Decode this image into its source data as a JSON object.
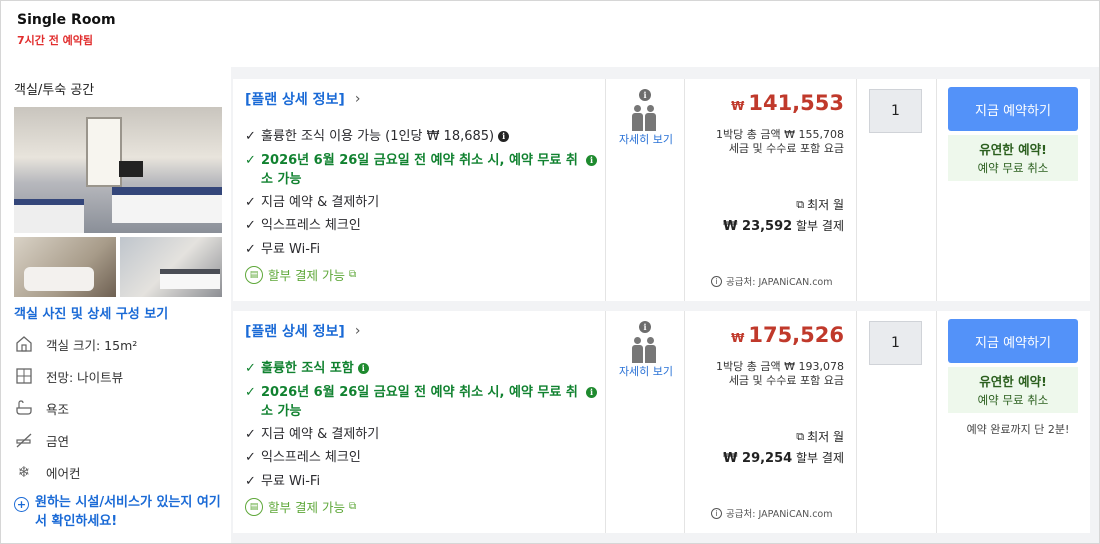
{
  "header": {
    "room_name": "Single Room",
    "booked_note": "7시간 전 예약됨"
  },
  "left_panel": {
    "section_title": "객실/투숙 공간",
    "photos_link": "객실 사진 및 상세 구성 보기",
    "amenities": [
      {
        "icon": "house-icon",
        "label": "객실 크기: 15m²"
      },
      {
        "icon": "window-icon",
        "label": "전망: 나이트뷰"
      },
      {
        "icon": "bathtub-icon",
        "label": "욕조"
      },
      {
        "icon": "no-smoking-icon",
        "label": "금연"
      },
      {
        "icon": "snowflake-icon",
        "label": "에어컨"
      }
    ],
    "more_link": "원하는 시설/서비스가 있는지 여기서 확인하세요!"
  },
  "offers": [
    {
      "plan_link": "[플랜 상세 정보]",
      "features": [
        {
          "text": "훌륭한 조식 이용 가능 (1인당 ₩ 18,685)",
          "green": false
        },
        {
          "text": "2026년 6월 26일 금요일 전 예약 취소 시, 예약 무료 취소 가능",
          "green": true
        },
        {
          "text": "지금 예약 & 결제하기",
          "green": false
        },
        {
          "text": "익스프레스 체크인",
          "green": false
        },
        {
          "text": "무료 Wi-Fi",
          "green": false
        }
      ],
      "installment": "할부 결제 가능",
      "people_detail": "자세히 보기",
      "currency": "₩",
      "price": "141,553",
      "per_night": "1박당 총 금액 ₩ 155,708",
      "tax_note": "세금 및 수수료 포함 요금",
      "lowest_monthly": "최저 월",
      "monthly_amount": "₩ 23,592",
      "monthly_suffix": "할부 결제",
      "supplier": "공급처: JAPANiCAN.com",
      "quantity": "1",
      "book_label": "지금 예약하기",
      "flex_title": "유연한 예약!",
      "flex_sub": "예약 무료 취소",
      "urgency": ""
    },
    {
      "plan_link": "[플랜 상세 정보]",
      "features": [
        {
          "text": "훌륭한 조식 포함",
          "green": true
        },
        {
          "text": "2026년 6월 26일 금요일 전 예약 취소 시, 예약 무료 취소 가능",
          "green": true
        },
        {
          "text": "지금 예약 & 결제하기",
          "green": false
        },
        {
          "text": "익스프레스 체크인",
          "green": false
        },
        {
          "text": "무료 Wi-Fi",
          "green": false
        }
      ],
      "installment": "할부 결제 가능",
      "people_detail": "자세히 보기",
      "currency": "₩",
      "price": "175,526",
      "per_night": "1박당 총 금액 ₩ 193,078",
      "tax_note": "세금 및 수수료 포함 요금",
      "lowest_monthly": "최저 월",
      "monthly_amount": "₩ 29,254",
      "monthly_suffix": "할부 결제",
      "supplier": "공급처: JAPANiCAN.com",
      "quantity": "1",
      "book_label": "지금 예약하기",
      "flex_title": "유연한 예약!",
      "flex_sub": "예약 무료 취소",
      "urgency": "예약 완료까지 단 2분!"
    }
  ]
}
